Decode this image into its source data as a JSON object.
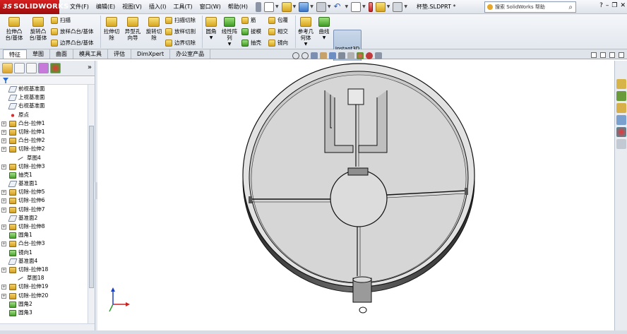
{
  "app": {
    "logo": "SOLIDWORKS",
    "document_title": "杯垫.SLDPRT *",
    "search_placeholder": "搜索 SolidWorks 帮助"
  },
  "menu": [
    "文件(F)",
    "编辑(E)",
    "视图(V)",
    "插入(I)",
    "工具(T)",
    "窗口(W)",
    "帮助(H)"
  ],
  "ribbon": {
    "extrude_boss": "拉伸凸台/基体",
    "revolve_boss": "旋转凸台/基体",
    "sweep": "扫描",
    "loft_boss": "放样凸台/基体",
    "boundary_boss": "边界凸台/基体",
    "extrude_cut": "拉伸切除",
    "hole_wizard": "异型孔向导",
    "revolve_cut": "旋转切除",
    "swept_cut": "扫描切除",
    "lofted_cut": "放样切割",
    "boundary_cut": "边界切除",
    "fillet": "圆角",
    "linear_pattern": "线性阵列",
    "rib": "筋",
    "wrap": "包覆",
    "draft": "拔模",
    "intersect": "相交",
    "shell": "抽壳",
    "mirror": "镜向",
    "ref_geometry": "参考几何体",
    "curves": "曲线",
    "instant3d": "Instant3D"
  },
  "tabs": [
    "特征",
    "草图",
    "曲面",
    "模具工具",
    "评估",
    "DimXpert",
    "办公室产品"
  ],
  "tree": [
    {
      "label": "前视基准面",
      "type": "plane",
      "expand": false
    },
    {
      "label": "上视基准面",
      "type": "plane",
      "expand": false
    },
    {
      "label": "右视基准面",
      "type": "plane",
      "expand": false
    },
    {
      "label": "原点",
      "type": "origin",
      "expand": false
    },
    {
      "label": "凸台-拉伸1",
      "type": "feature",
      "expand": true
    },
    {
      "label": "切除-拉伸1",
      "type": "feature",
      "expand": true
    },
    {
      "label": "凸台-拉伸2",
      "type": "feature",
      "expand": true
    },
    {
      "label": "切除-拉伸2",
      "type": "feature",
      "expand": true
    },
    {
      "label": "草图4",
      "type": "sketch",
      "expand": false,
      "sub": true
    },
    {
      "label": "切除-拉伸3",
      "type": "feature",
      "expand": true
    },
    {
      "label": "抽壳1",
      "type": "featureg",
      "expand": false
    },
    {
      "label": "基准面1",
      "type": "plane",
      "expand": false
    },
    {
      "label": "切除-拉伸5",
      "type": "feature",
      "expand": true
    },
    {
      "label": "切除-拉伸6",
      "type": "feature",
      "expand": true
    },
    {
      "label": "切除-拉伸7",
      "type": "feature",
      "expand": true
    },
    {
      "label": "基准面2",
      "type": "plane",
      "expand": false
    },
    {
      "label": "切除-拉伸8",
      "type": "feature",
      "expand": true
    },
    {
      "label": "圆角1",
      "type": "featureg",
      "expand": false
    },
    {
      "label": "凸台-拉伸3",
      "type": "feature",
      "expand": true
    },
    {
      "label": "镜向1",
      "type": "featureg",
      "expand": false
    },
    {
      "label": "基准面4",
      "type": "plane",
      "expand": false
    },
    {
      "label": "切除-拉伸18",
      "type": "feature",
      "expand": true
    },
    {
      "label": "草图18",
      "type": "sketch",
      "expand": false,
      "sub": true
    },
    {
      "label": "切除-拉伸19",
      "type": "feature",
      "expand": true
    },
    {
      "label": "切除-拉伸20",
      "type": "feature",
      "expand": true
    },
    {
      "label": "圆角2",
      "type": "featureg",
      "expand": false
    },
    {
      "label": "圆角3",
      "type": "featureg",
      "expand": false
    }
  ],
  "colors": {
    "model_fill": "#d4d4d4",
    "model_wall": "#3f3f3f",
    "model_stroke": "#111111"
  }
}
